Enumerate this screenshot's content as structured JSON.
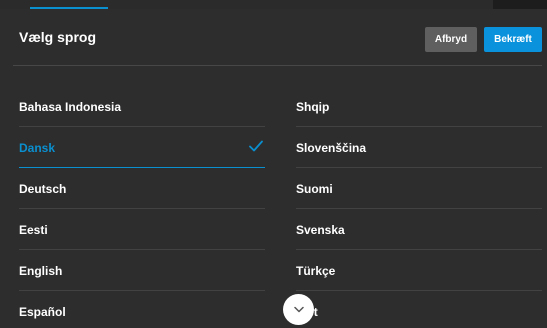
{
  "dialog": {
    "title": "Vælg sprog",
    "cancel_label": "Afbryd",
    "confirm_label": "Bekræft"
  },
  "languages_left": [
    {
      "label": "Bahasa Indonesia",
      "selected": false
    },
    {
      "label": "Dansk",
      "selected": true
    },
    {
      "label": "Deutsch",
      "selected": false
    },
    {
      "label": "Eesti",
      "selected": false
    },
    {
      "label": "English",
      "selected": false
    },
    {
      "label": "Español",
      "selected": false
    }
  ],
  "languages_right": [
    {
      "label": "Shqip"
    },
    {
      "label": "Slovenščina"
    },
    {
      "label": "Suomi"
    },
    {
      "label": "Svenska"
    },
    {
      "label": "Türkçe"
    },
    {
      "label": "Việt"
    }
  ],
  "icons": {
    "selected_check": "checkmark-icon",
    "scroll_down": "chevron-down-icon"
  },
  "colors": {
    "accent": "#0a8fcf",
    "background": "#2d2d2d",
    "cancel_button": "#5f5f5f",
    "confirm_button": "#0a93dc"
  }
}
